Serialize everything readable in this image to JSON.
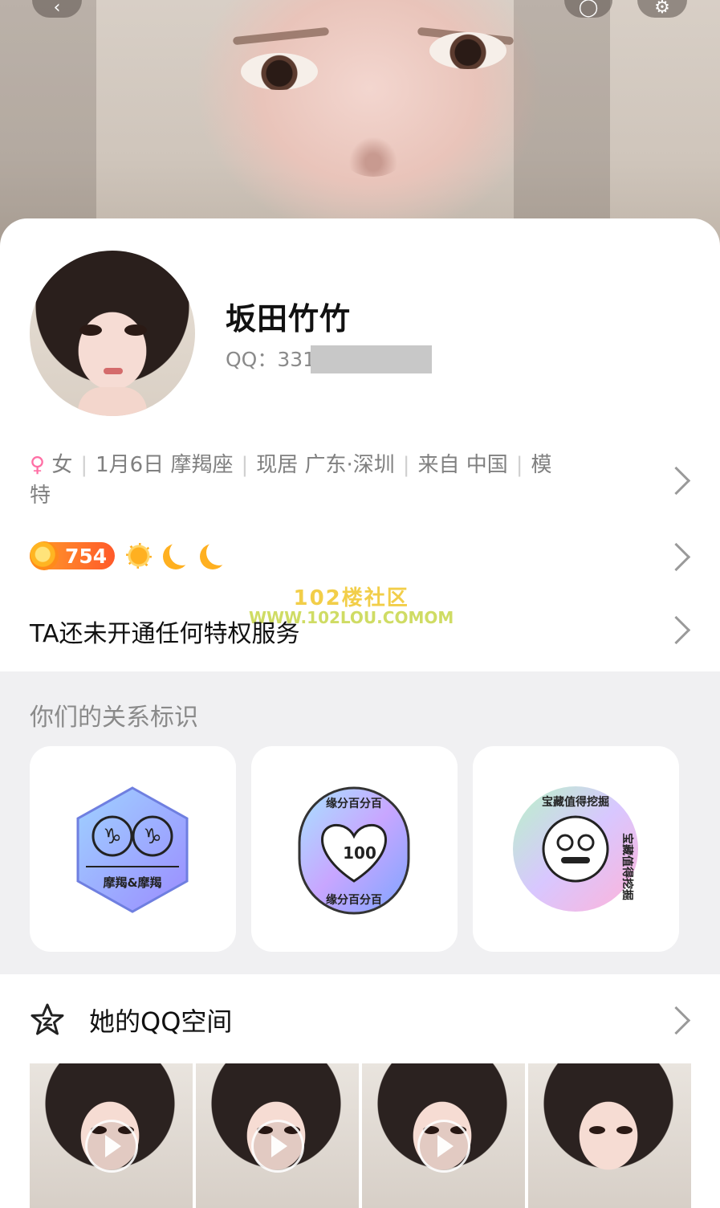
{
  "profile": {
    "name": "坂田竹竹",
    "qq_label": "QQ：331"
  },
  "info": {
    "gender_symbol": "♀",
    "gender": "女",
    "birthday": "1月6日 摩羯座",
    "residence": "现居 广东·深圳",
    "origin": "来自 中国",
    "occupation_line1": "模",
    "occupation_line2": "特"
  },
  "level": {
    "value": "754"
  },
  "watermark": {
    "line1": "102楼社区",
    "line2": "WWW.102LOU.COMOM"
  },
  "privilege": {
    "text": "TA还未开通任何特权服务"
  },
  "relation": {
    "title": "你们的关系标识",
    "badges": [
      {
        "caption": "摩羯&摩羯",
        "symbols": "♑♑"
      },
      {
        "ring_text": "缘分百分百",
        "center": "100"
      },
      {
        "ring_text_top": "宝藏值得挖掘",
        "ring_text_side": "宝藏值得挖掘"
      }
    ]
  },
  "qzone": {
    "title": "她的QQ空间"
  }
}
